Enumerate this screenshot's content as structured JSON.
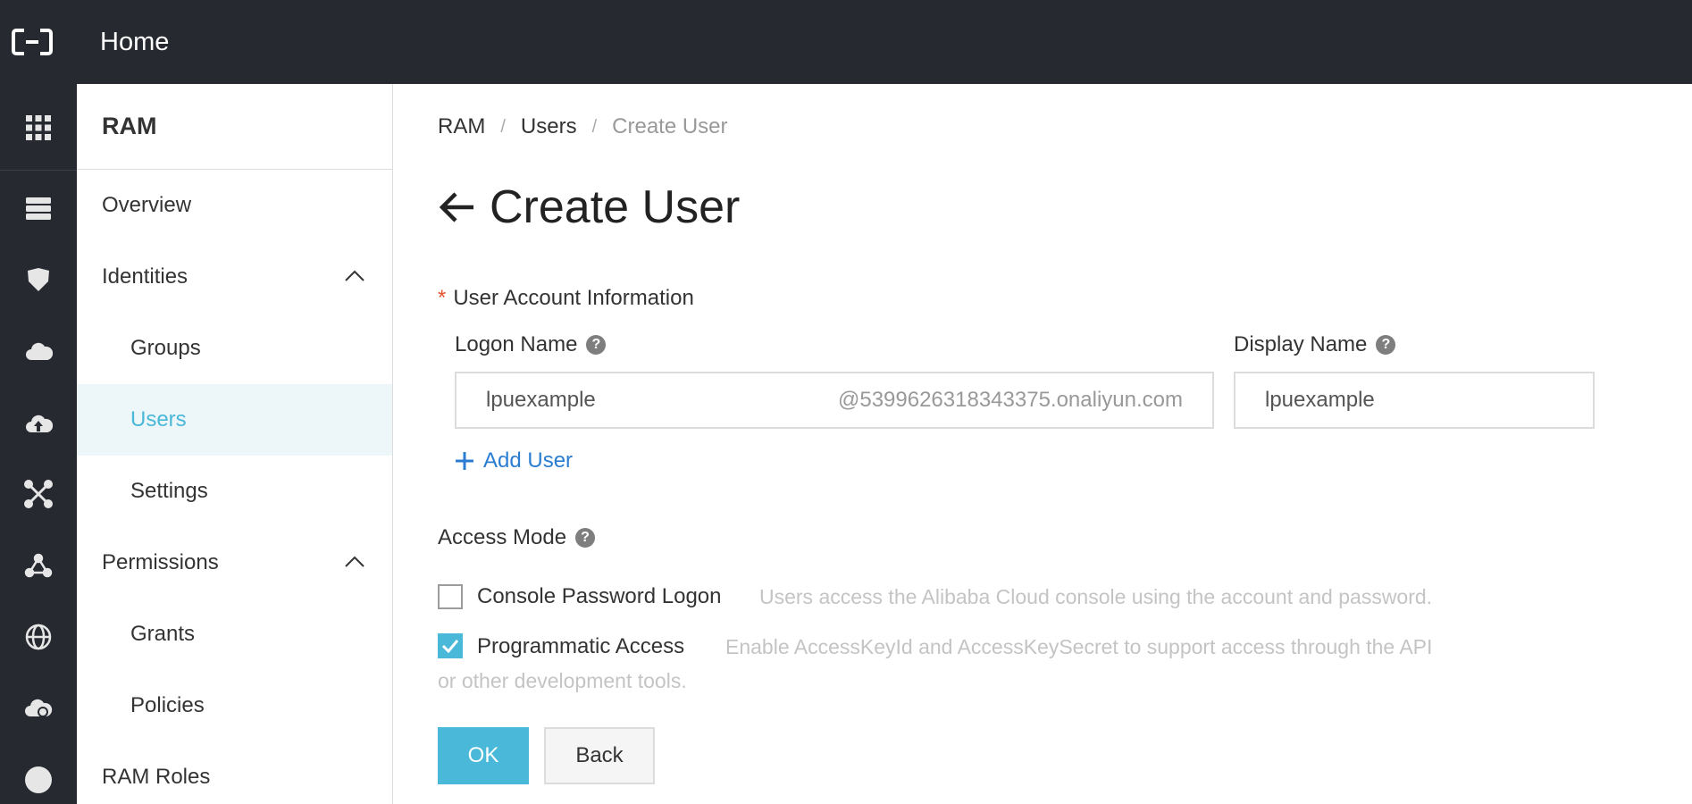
{
  "topbar": {
    "home_label": "Home",
    "logo_icon": "aliyun-logo-icon"
  },
  "rail": {
    "icons": [
      "apps-grid-icon",
      "storage-icon",
      "shield-icon",
      "cloud-icon",
      "cloud-upload-icon",
      "network-icon",
      "cluster-icon",
      "globe-icon",
      "settings-cloud-icon",
      "circle-icon"
    ]
  },
  "sidebar": {
    "title": "RAM",
    "items": [
      {
        "label": "Overview"
      },
      {
        "label": "Identities"
      },
      {
        "label": "Groups"
      },
      {
        "label": "Users"
      },
      {
        "label": "Settings"
      },
      {
        "label": "Permissions"
      },
      {
        "label": "Grants"
      },
      {
        "label": "Policies"
      },
      {
        "label": "RAM Roles"
      }
    ]
  },
  "breadcrumb": {
    "items": [
      "RAM",
      "Users",
      "Create User"
    ],
    "separator": "/"
  },
  "page": {
    "title": "Create User"
  },
  "form": {
    "required_marker": "*",
    "section_label": "User Account Information",
    "logon_name_label": "Logon Name",
    "logon_name_value": "lpuexample",
    "logon_name_suffix": "@5399626318343375.onaliyun.com",
    "display_name_label": "Display Name",
    "display_name_value": "lpuexample",
    "help_glyph": "?",
    "add_user_label": "Add User",
    "access_mode_label": "Access Mode",
    "console_label": "Console Password Logon",
    "console_desc": "Users access the Alibaba Cloud console using the account and password.",
    "console_checked": false,
    "programmatic_label": "Programmatic Access",
    "programmatic_desc_line1": "Enable AccessKeyId and AccessKeySecret to support access through the API",
    "programmatic_desc_line2": "or other development tools.",
    "programmatic_checked": true,
    "ok_label": "OK",
    "back_label": "Back"
  },
  "colors": {
    "accent": "#4ab8d8",
    "link": "#2a7dd0",
    "topbar": "#262a30",
    "required": "#e8522d"
  }
}
